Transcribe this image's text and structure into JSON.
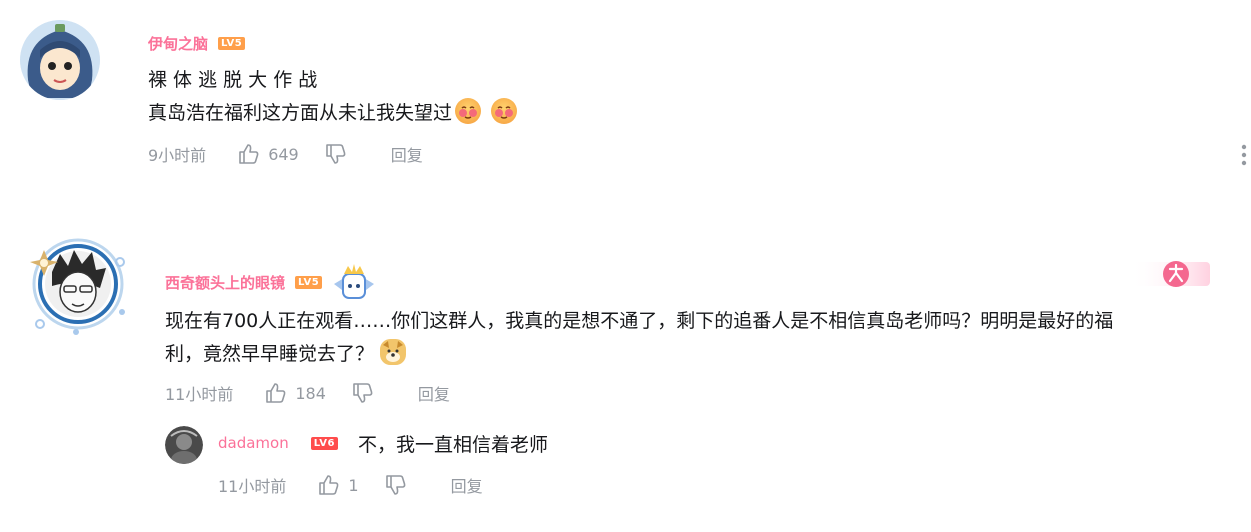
{
  "comments": [
    {
      "username": "伊甸之脑",
      "level": "LV5",
      "lines": [
        "裸 体 逃 脱 大 作 战",
        "真岛浩在福利这方面从未让我失望过"
      ],
      "time": "9小时前",
      "likes": "649",
      "reply_label": "回复"
    },
    {
      "username": "西奇额头上的眼镜",
      "level": "LV5",
      "lines": [
        "现在有700人正在观看……你们这群人，我真的是想不通了，剩下的追番人是不相信真岛老师吗？明明是最好的福",
        "利，竟然早早睡觉去了？"
      ],
      "time": "11小时前",
      "likes": "184",
      "reply_label": "回复"
    }
  ],
  "reply": {
    "username": "dadamon",
    "level": "LV6",
    "text": "不，我一直相信着老师",
    "time": "11小时前",
    "likes": "1",
    "reply_label": "回复"
  },
  "colors": {
    "username": "#fb7299",
    "meta": "#9499a0",
    "text": "#18191c"
  }
}
